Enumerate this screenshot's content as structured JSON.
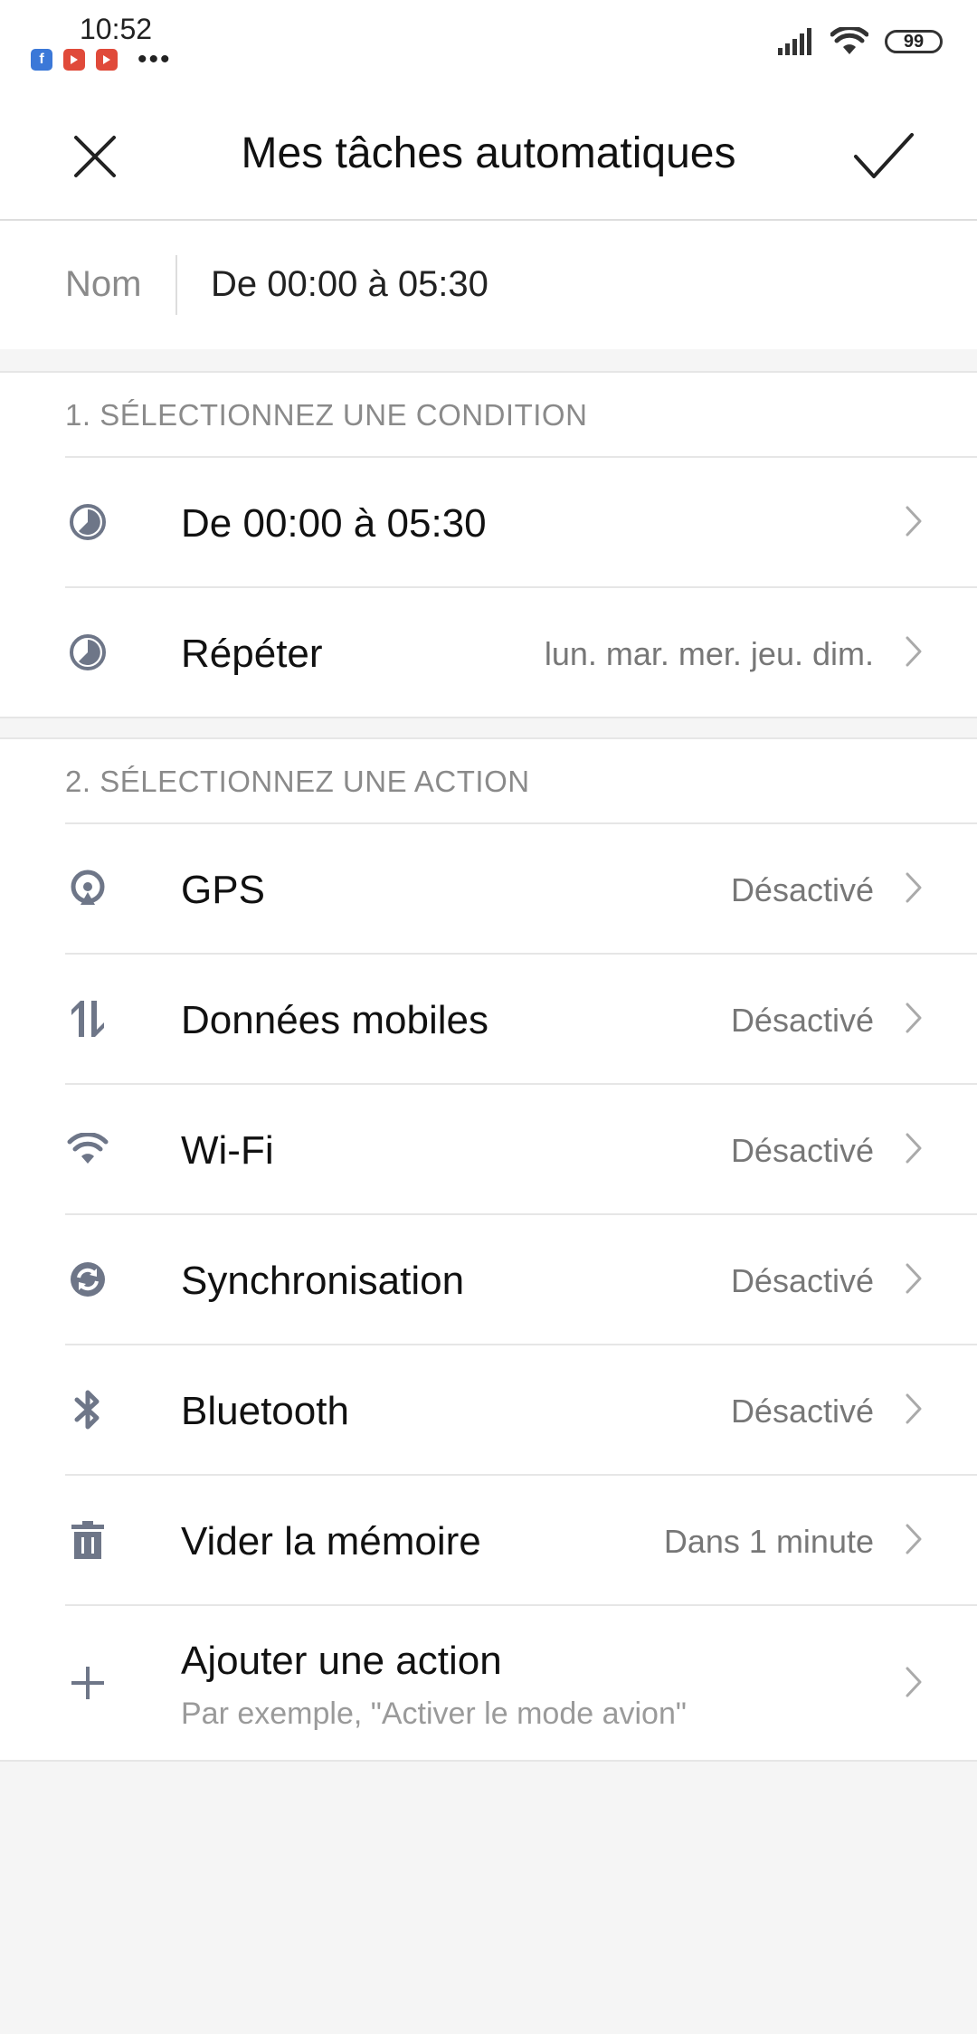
{
  "status_bar": {
    "time": "10:52",
    "notifications": [
      "facebook-icon",
      "youtube-icon",
      "youtube-icon"
    ],
    "overflow": "•••",
    "battery": "99"
  },
  "header": {
    "title": "Mes tâches automatiques"
  },
  "name_field": {
    "label": "Nom",
    "value": "De 00:00 à 05:30"
  },
  "condition_section": {
    "title": "1. SÉLECTIONNEZ UNE CONDITION",
    "rows": [
      {
        "label": "De 00:00 à 05:30",
        "value": "",
        "icon": "clock-icon"
      },
      {
        "label": "Répéter",
        "value": "lun. mar. mer. jeu. dim.",
        "icon": "clock-icon"
      }
    ]
  },
  "action_section": {
    "title": "2. SÉLECTIONNEZ UNE ACTION",
    "rows": [
      {
        "label": "GPS",
        "value": "Désactivé",
        "icon": "gps-icon"
      },
      {
        "label": "Données mobiles",
        "value": "Désactivé",
        "icon": "mobile-data-icon"
      },
      {
        "label": "Wi-Fi",
        "value": "Désactivé",
        "icon": "wifi-icon"
      },
      {
        "label": "Synchronisation",
        "value": "Désactivé",
        "icon": "sync-icon"
      },
      {
        "label": "Bluetooth",
        "value": "Désactivé",
        "icon": "bluetooth-icon"
      },
      {
        "label": "Vider la mémoire",
        "value": "Dans 1 minute",
        "icon": "trash-icon"
      }
    ],
    "add_action": {
      "label": "Ajouter une action",
      "sublabel": "Par exemple, \"Activer le mode avion\"",
      "icon": "plus-icon"
    }
  },
  "colors": {
    "icon_gray": "#6e7688",
    "background": "#f5f5f5"
  }
}
